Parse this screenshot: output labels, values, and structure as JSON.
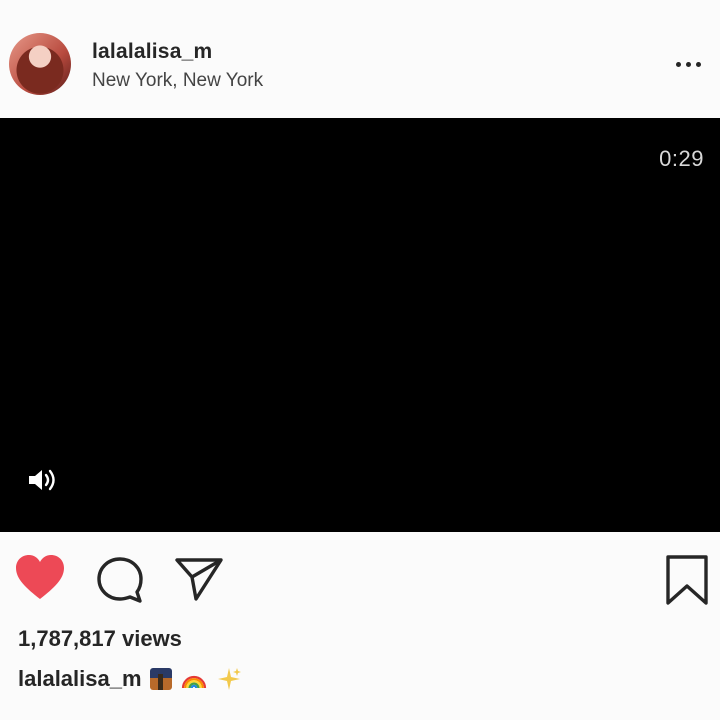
{
  "post": {
    "username": "lalalalisa_m",
    "location": "New York, New York"
  },
  "video": {
    "duration": "0:29"
  },
  "stats": {
    "views": "1,787,817 views"
  },
  "caption": {
    "username": "lalalalisa_m",
    "emojis": [
      "night-city-icon",
      "rainbow-icon",
      "sparkles-icon"
    ]
  },
  "colors": {
    "like_red": "#ed4956",
    "text": "#262626"
  },
  "icons": [
    "more-options-icon",
    "sound-icon",
    "heart-icon",
    "comment-icon",
    "share-icon",
    "bookmark-icon"
  ]
}
